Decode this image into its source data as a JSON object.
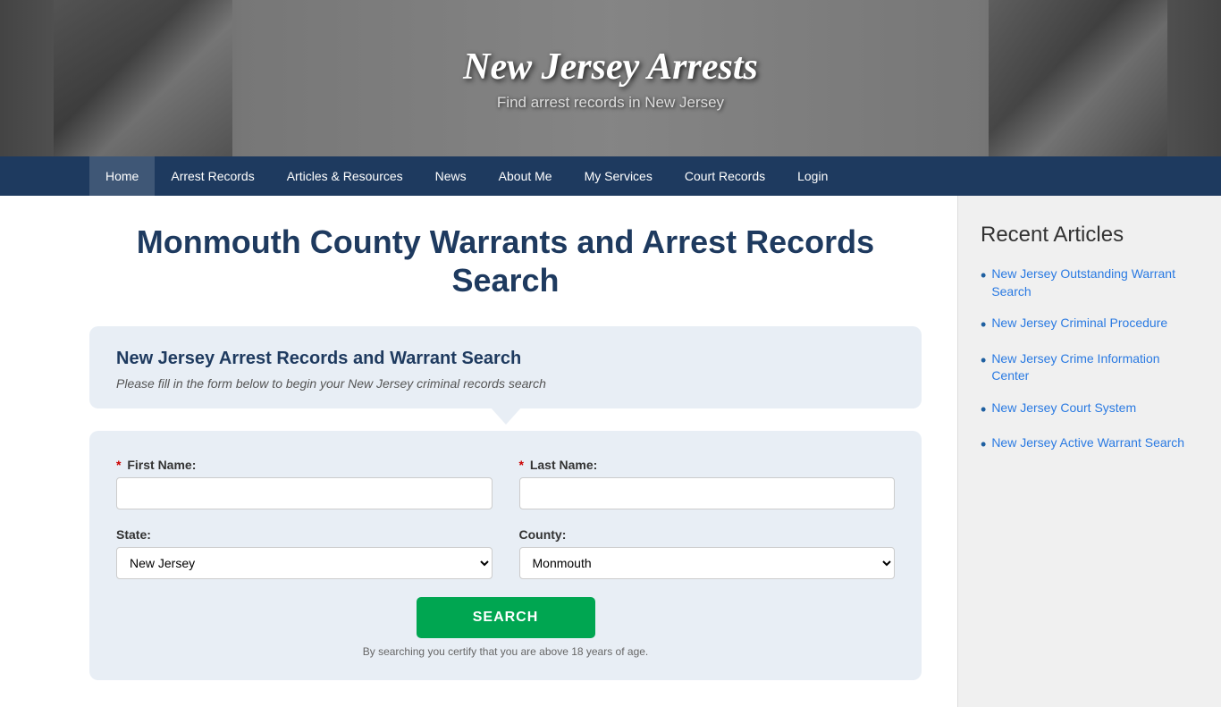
{
  "banner": {
    "title": "New Jersey Arrests",
    "subtitle": "Find arrest records in New Jersey"
  },
  "nav": {
    "items": [
      {
        "label": "Home",
        "active": true
      },
      {
        "label": "Arrest Records",
        "active": false
      },
      {
        "label": "Articles & Resources",
        "active": false
      },
      {
        "label": "News",
        "active": false
      },
      {
        "label": "About Me",
        "active": false
      },
      {
        "label": "My Services",
        "active": false
      },
      {
        "label": "Court Records",
        "active": false
      },
      {
        "label": "Login",
        "active": false
      }
    ]
  },
  "main": {
    "page_title": "Monmouth County Warrants and Arrest Records Search",
    "search_box": {
      "title": "New Jersey Arrest Records and Warrant Search",
      "subtitle": "Please fill in the form below to begin your New Jersey criminal records search"
    },
    "form": {
      "first_name_label": "First Name:",
      "last_name_label": "Last Name:",
      "state_label": "State:",
      "county_label": "County:",
      "state_value": "New Jersey",
      "county_value": "Monmouth",
      "search_button": "SEARCH",
      "note": "By searching you certify that you are above 18 years of age."
    }
  },
  "sidebar": {
    "title": "Recent Articles",
    "articles": [
      {
        "label": "New Jersey Outstanding Warrant Search"
      },
      {
        "label": "New Jersey Criminal Procedure"
      },
      {
        "label": "New Jersey Crime Information Center"
      },
      {
        "label": "New Jersey Court System"
      },
      {
        "label": "New Jersey Active Warrant Search"
      }
    ]
  }
}
